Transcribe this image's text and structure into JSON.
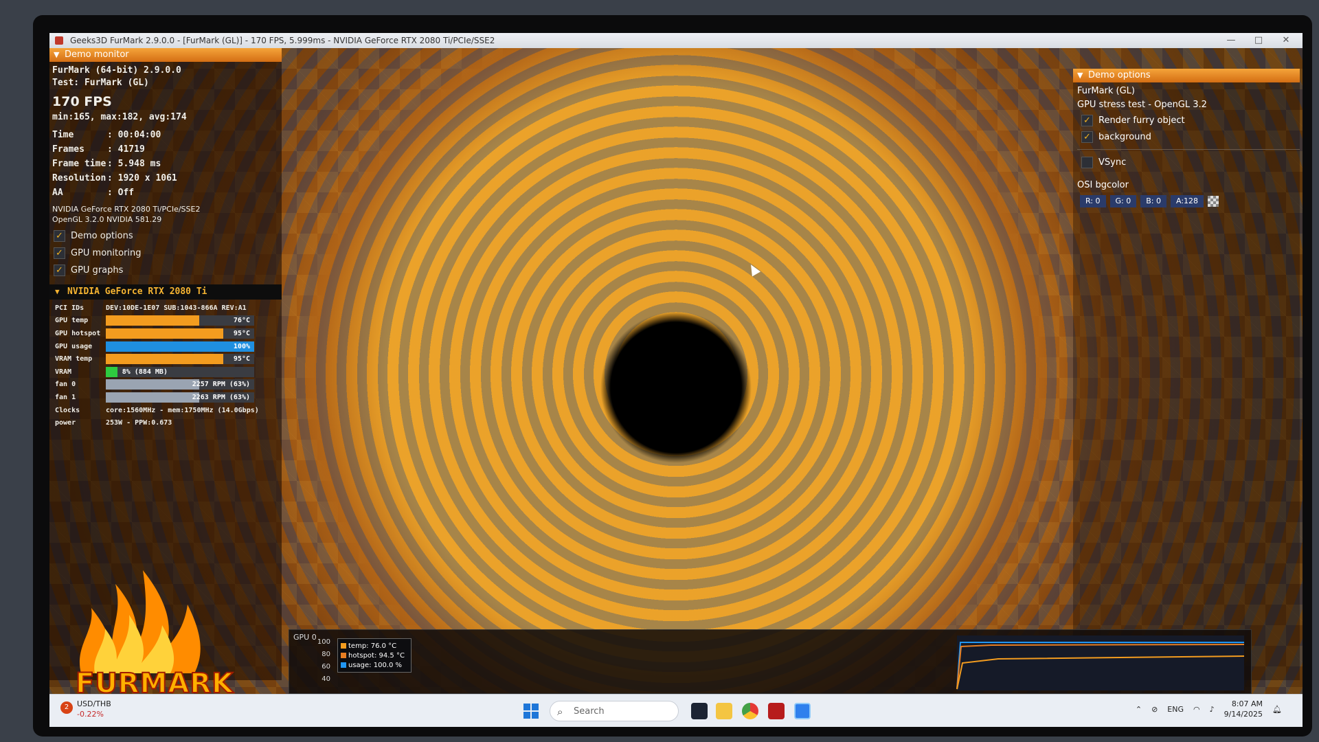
{
  "window": {
    "title": "Geeks3D FurMark 2.9.0.0 - [FurMark (GL)] - 170 FPS, 5.999ms - NVIDIA GeForce RTX 2080 Ti/PCIe/SSE2",
    "minimize": "—",
    "maximize": "□",
    "close": "✕"
  },
  "demo_monitor": {
    "header": "Demo monitor",
    "app": "FurMark (64-bit) 2.9.0.0",
    "test": "Test: FurMark (GL)",
    "fps": "170 FPS",
    "fps_stats": "min:165, max:182, avg:174",
    "stats": [
      {
        "k": "Time",
        "v": ": 00:04:00"
      },
      {
        "k": "Frames",
        "v": ": 41719"
      },
      {
        "k": "Frame time",
        "v": ": 5.948 ms"
      },
      {
        "k": "Resolution",
        "v": ": 1920 x 1061"
      },
      {
        "k": "AA",
        "v": ": Off"
      }
    ],
    "gpu_name": "NVIDIA GeForce RTX 2080 Ti/PCIe/SSE2",
    "gl_version": "OpenGL 3.2.0 NVIDIA 581.29",
    "checks": [
      {
        "label": "Demo options",
        "checked": true
      },
      {
        "label": "GPU monitoring",
        "checked": true
      },
      {
        "label": "GPU graphs",
        "checked": true
      }
    ]
  },
  "gpu_panel": {
    "header": "NVIDIA GeForce RTX 2080 Ti",
    "pci_label": "PCI IDs",
    "pci_value": "DEV:10DE-1E07 SUB:1043-866A REV:A1",
    "bars": [
      {
        "label": "GPU temp",
        "text": "76°C",
        "fill": 0.63,
        "color": "#f39c1f"
      },
      {
        "label": "GPU hotspot",
        "text": "95°C",
        "fill": 0.79,
        "color": "#f39c1f"
      },
      {
        "label": "GPU usage",
        "text": "100%",
        "fill": 1.0,
        "color": "#1f8fe0"
      },
      {
        "label": "VRAM temp",
        "text": "95°C",
        "fill": 0.79,
        "color": "#f39c1f"
      },
      {
        "label": "VRAM",
        "text": "8% (884 MB)",
        "fill": 0.08,
        "color": "#2ecc40"
      },
      {
        "label": "fan 0",
        "text": "2257 RPM (63%)",
        "fill": 0.63,
        "color": "#9aa4b2"
      },
      {
        "label": "fan 1",
        "text": "2263 RPM (63%)",
        "fill": 0.63,
        "color": "#9aa4b2"
      }
    ],
    "clocks_label": "Clocks",
    "clocks_value": "core:1560MHz - mem:1750MHz (14.0Gbps)",
    "power_label": "power",
    "power_value": "253W - PPW:0.673"
  },
  "demo_options": {
    "header": "Demo options",
    "title": "FurMark (GL)",
    "subtitle": "GPU stress test - OpenGL 3.2",
    "checks": [
      {
        "label": "Render furry object",
        "checked": true
      },
      {
        "label": "background",
        "checked": true
      }
    ],
    "vsync": {
      "label": "VSync",
      "checked": false
    },
    "osi_label": "OSI bgcolor",
    "rgba": [
      "R: 0",
      "G: 0",
      "B: 0",
      "A:128"
    ]
  },
  "graph": {
    "label": "GPU 0",
    "yticks": [
      "100",
      "80",
      "60",
      "40"
    ],
    "legend": [
      {
        "text": "temp: 76.0 °C",
        "color": "#f39c1f"
      },
      {
        "text": "hotspot: 94.5 °C",
        "color": "#e67e22"
      },
      {
        "text": "usage: 100.0 %",
        "color": "#2196f3"
      }
    ]
  },
  "logo": {
    "text": "FURMARK"
  },
  "taskbar": {
    "weather_title": "USD/THB",
    "weather_change": "-0.22%",
    "weather_badge": "2",
    "search_placeholder": "Search",
    "lang": "ENG",
    "time": "8:07 AM",
    "date": "9/14/2025"
  }
}
